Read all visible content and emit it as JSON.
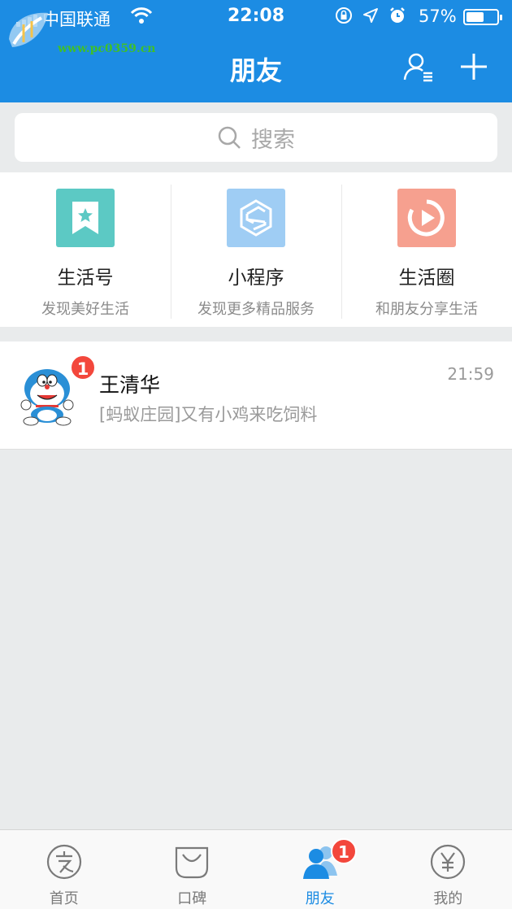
{
  "status_bar": {
    "carrier": "中国联通",
    "time": "22:08",
    "battery": "57%",
    "battery_level": 0.57
  },
  "watermark": {
    "url": "www.pc0359.cn"
  },
  "header": {
    "title": "朋友",
    "contacts_icon": "contacts-icon",
    "add_icon": "plus-icon"
  },
  "search": {
    "placeholder": "搜索"
  },
  "features": [
    {
      "title": "生活号",
      "subtitle": "发现美好生活",
      "icon": "bookmark-star-icon",
      "color": "#5cc9c4"
    },
    {
      "title": "小程序",
      "subtitle": "发现更多精品服务",
      "icon": "mini-program-icon",
      "color": "#9fcdf4"
    },
    {
      "title": "生活圈",
      "subtitle": "和朋友分享生活",
      "icon": "play-circle-icon",
      "color": "#f6a08f"
    }
  ],
  "chats": [
    {
      "name": "王清华",
      "message": "[蚂蚁庄园]又有小鸡来吃饲料",
      "time": "21:59",
      "badge": "1",
      "avatar": "doraemon-avatar"
    }
  ],
  "tabs": [
    {
      "label": "首页",
      "icon": "alipay-icon",
      "active": false
    },
    {
      "label": "口碑",
      "icon": "koubei-icon",
      "active": false
    },
    {
      "label": "朋友",
      "icon": "friends-icon",
      "active": true,
      "badge": "1"
    },
    {
      "label": "我的",
      "icon": "yuan-icon",
      "active": false
    }
  ],
  "colors": {
    "brand_blue": "#1c8ce3",
    "badge_red": "#f3473c",
    "background": "#e9ebec"
  }
}
